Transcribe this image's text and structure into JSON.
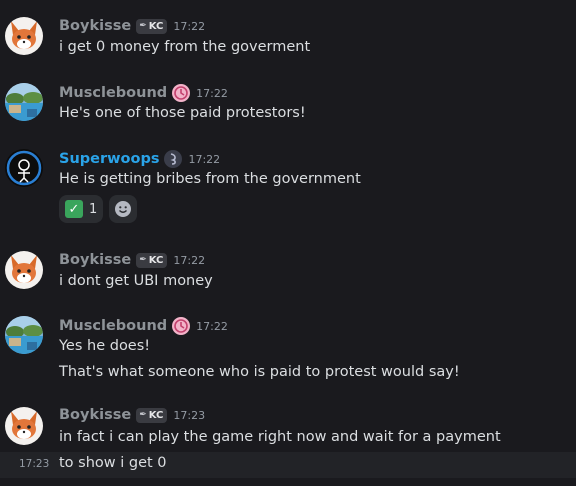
{
  "colors": {
    "background": "#1a1a1e",
    "username_default": "#8e9398",
    "username_superwoops": "#2aa3e8",
    "message_text": "#dbdee1",
    "timestamp": "#949ba4"
  },
  "messages": [
    {
      "author": "Boykisse",
      "tag": "KC",
      "time": "17:22",
      "lines": [
        "i get 0 money from the goverment"
      ]
    },
    {
      "author": "Musclebound",
      "time": "17:22",
      "lines": [
        "He's one of those paid protestors!"
      ]
    },
    {
      "author": "Superwoops",
      "time": "17:22",
      "lines": [
        "He is getting bribes from the government"
      ],
      "reactions": [
        {
          "emoji": "white-check-mark",
          "count": "1"
        }
      ]
    },
    {
      "author": "Boykisse",
      "tag": "KC",
      "time": "17:22",
      "lines": [
        "i dont get UBI money"
      ]
    },
    {
      "author": "Musclebound",
      "time": "17:22",
      "lines": [
        "Yes he does!",
        "That's what someone who is paid to protest would say!"
      ]
    },
    {
      "author": "Boykisse",
      "tag": "KC",
      "time": "17:23",
      "lines": [
        "in fact i can play the game right now and wait for a payment"
      ]
    }
  ],
  "hover_message": {
    "time": "17:23",
    "text": "to show i get 0"
  }
}
